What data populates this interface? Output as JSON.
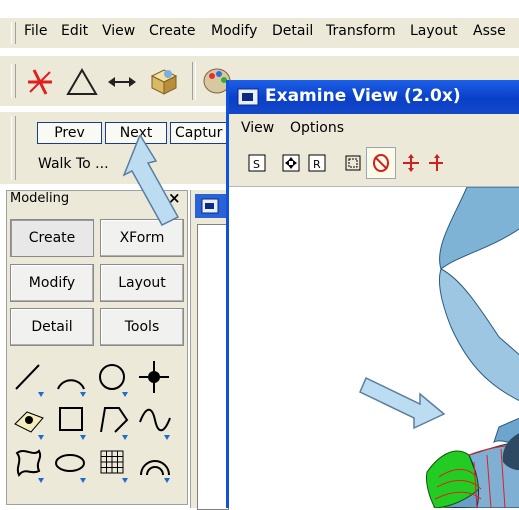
{
  "menubar": {
    "items": [
      "File",
      "Edit",
      "View",
      "Create",
      "Modify",
      "Detail",
      "Transform",
      "Layout",
      "Asse"
    ]
  },
  "walk_toolbar": {
    "prev_label": "Prev",
    "next_label": "Next",
    "capture_label": "Captur",
    "walk_to_label": "Walk To ..."
  },
  "modeling_panel": {
    "title": "Modeling",
    "close_glyph": "×",
    "buttons": [
      "Create",
      "XForm",
      "Modify",
      "Layout",
      "Detail",
      "Tools"
    ],
    "tool_icons": [
      "line-icon",
      "arc-icon",
      "circle-icon",
      "point-icon",
      "surface-point-icon",
      "rectangle-icon",
      "polyline-icon",
      "spline-icon",
      "blob-icon",
      "ellipse-icon",
      "grid-icon",
      "fillet-icon"
    ]
  },
  "examine_view": {
    "title": "Examine View (2.0x)",
    "menu": [
      "View",
      "Options"
    ],
    "toolbar_icons": [
      "s-icon",
      "fit-icon",
      "r-icon",
      "box-icon",
      "rotate-icon",
      "pan-icon",
      "axis-icon"
    ]
  },
  "colors": {
    "title_bar": "#0a3fc8",
    "toolbar_bg": "#ece9d8",
    "model_blue": "#7eb3d6",
    "model_green": "#22cc22",
    "callout_arrow": "#bcdcf2"
  }
}
